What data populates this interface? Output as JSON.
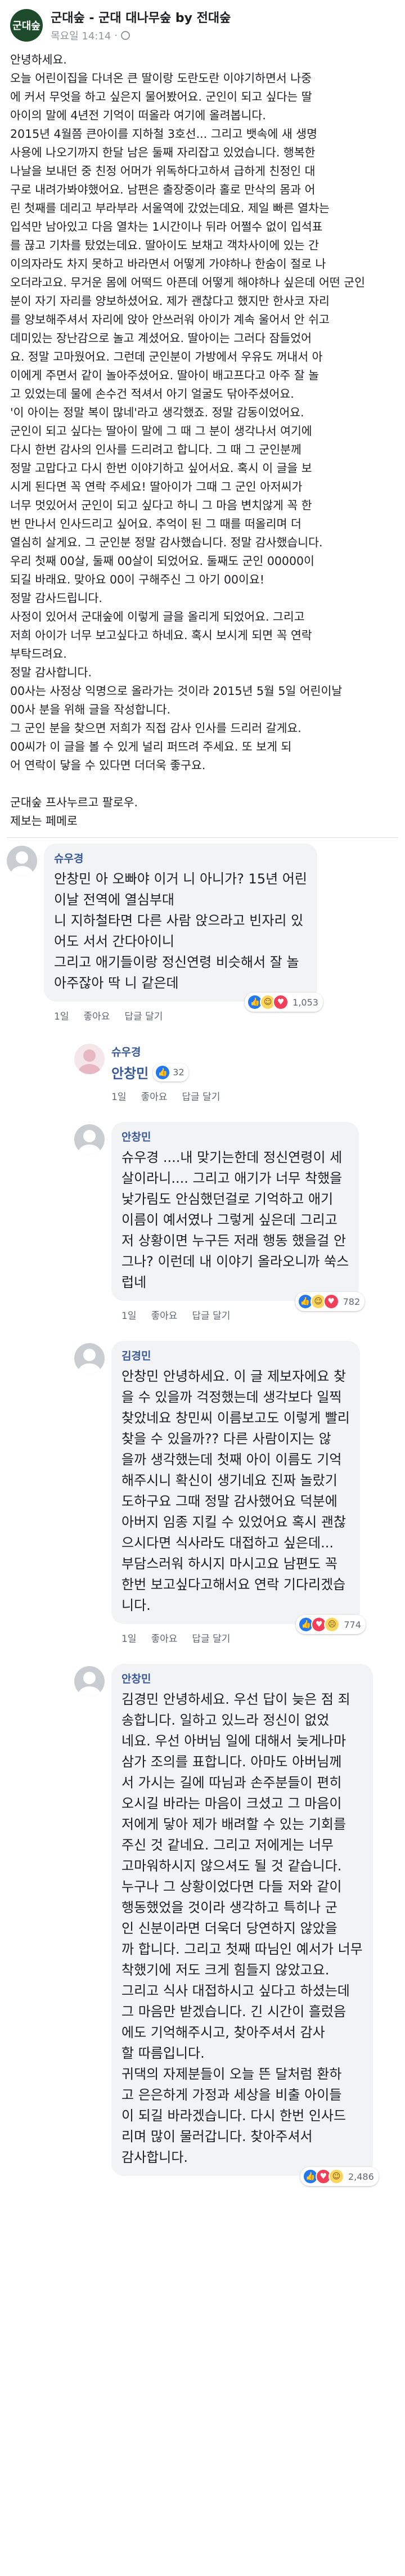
{
  "post": {
    "title": "군대숲 - 군대 대나무숲 by 전대숲",
    "avatar_text": "군대숲",
    "time": "목요일 14:14",
    "privacy_dot": "·",
    "body": "안녕하세요.\n오늘 어린이집을 다녀온 큰 딸이랑 도란도란 이야기하면서 나중\n에 커서 무엇을 하고 싶은지 물어봤어요. 군인이 되고 싶다는 딸\n아이의 말에 4년전 기억이 떠올라 여기에 올려봅니다.\n2015년 4월쯤 큰아이를 지하철 3호선... 그리고 뱃속에 새 생명\n사용에 나오기까지 한달 남은 둘째 자리잡고 있었습니다. 행복한\n나날을 보내던 중 친정 어머가 위독하다고하셔 급하게 친정인 대\n구로 내려가봐야했어요. 남편은 출장중이라 홀로 만삭의 몸과 어\n린 첫째를 데리고 부라부라 서울역에 갔었는데요. 제일 빠른 열차는\n입석만 남아있고 다음 열차는 1시간이나 뒤라 어쩔수 없이 입석표\n를 끊고 기차를 탔었는데요. 딸아이도 보채고 객차사이에 있는 간\n이의자라도 차지 못하고 바라면서 어떻게 가야하나 한숨이 절로 나\n오더라고요. 무거운 몸에 어떡드 아픈데 어떻게 해야하나 싶은데 어떤 군인\n분이 자기 자리를 양보하셨어요. 제가 괜찮다고 했지만 한사코 자리\n를 양보해주셔서 자리에 앉아 안쓰러워 아이가 계속 울어서 안 쉬고\n데미있는 장난감으로 놀고 계셨어요. 딸아이는 그러다 잠들었어\n요. 정말 고마웠어요. 그런데 군인분이 가방에서 우유도 꺼내서 아\n이에게 주면서 같이 놀아주셨어요. 딸아이 배고프다고 아주 잘 놀\n고 있었는데 물에 손수건 적셔서 아기 얼굴도 닦아주셨어요.\n'이 아이는 정말 복이 많네'라고 생각했죠. 정말 감동이었어요.\n군인이 되고 싶다는 딸아이 말에 그 때 그 분이 생각나서 여기에\n다시 한번 감사의 인사를 드리려고 합니다. 그 때 그 군인분께\n정말 고맙다고 다시 한번 이야기하고 싶어서요. 혹시 이 글을 보\n시게 된다면 꼭 연락 주세요! 딸아이가 그때 그 군인 아저씨가\n너무 멋있어서 군인이 되고 싶다고 하니 그 마음 변치않게 꼭 한\n번 만나서 인사드리고 싶어요. 추억이 된 그 때를 떠올리며 더 \n열심히 살게요. 그 군인분 정말 감사했습니다. 정말 감사했습니다.\n우리 첫째 00살, 둘째 00살이 되었어요. 둘째도 군인 00000이\n되길 바래요. 맞아요 00이 구해주신 그 아기 00이요!\n정말 감사드립니다.\n사정이 있어서 군대숲에 이렇게 글을 올리게 되었어요. 그리고\n저희 아이가 너무 보고싶다고 하네요. 혹시 보시게 되면 꼭 연락\n부탁드려요.\n정말 감사합니다.\n00사는 사정상 익명으로 올라가는 것이라 2015년 5월 5일 어린이날\n00사 분을 위해 글을 작성합니다.\n그 군인 분을 찾으면 저희가 직접 감사 인사를 드리러 갈게요.\n00씨가 이 글을 볼 수 있게 널리 퍼뜨려 주세요. 또 보게 되\n어 연락이 닿을 수 있다면 더더욱 좋구요.\n\n군대숲 프사누르고 팔로우.\n제보는 페메로"
  },
  "comments": [
    {
      "name": "슈우경",
      "text": "안창민 아 오빠야 이거 니 아니가? 15년 어린\n이날 전역에 열심부대\n니 지하철타면 다른 사람 앉으라고 빈자리 있\n어도 서서 간다아이니\n그리고 애기들이랑 정신연령 비슷해서 잘 놀\n아주잖아 딱 니 같은데",
      "reaction_count": "1,053",
      "actions": [
        "1일",
        "좋아요",
        "답글 달기"
      ]
    },
    {
      "name": "슈우경",
      "text": "안창민",
      "like_count": "32",
      "actions": [
        "1일",
        "좋아요",
        "답글 달기"
      ]
    },
    {
      "name": "안창민",
      "text": "슈우경 ....내 맞기는한데 정신연령이 세\n살이라니.... 그리고 애기가 너무 착했을\n낯가림도 안심했던걸로 기억하고 애기\n이름이 예서였나 그렇게 싶은데 그리고\n저 상황이면 누구든 저래 행동 했을걸 안\n그나? 이런데 내 이야기 올라오니까 쑥스\n럽네",
      "reaction_count": "782",
      "actions": [
        "1일",
        "좋아요",
        "답글 달기"
      ]
    },
    {
      "name": "김경민",
      "text": "안창민 안녕하세요. 이 글 제보자에요 찾\n을 수 있을까 걱정했는데 생각보다 일찍\n찾았네요 창민씨 이름보고도 이렇게 빨리\n찾을 수 있을까?? 다른 사람이지는 않\n을까 생각했는데 첫째 아이 이름도 기억\n해주시니 확신이 생기네요 진짜 놀랐기\n도하구요 그때 정말 감사했어요 덕분에\n아버지 임종 지킬 수 있었어요 혹시 괜찮\n으시다면 식사라도 대접하고 싶은데...\n부담스러워 하시지 마시고요 남편도 꼭\n한번 보고싶다고해서요 연락 기다리겠습\n니다.",
      "reaction_count": "774",
      "actions": [
        "1일",
        "좋아요",
        "답글 달기"
      ]
    },
    {
      "name": "안창민",
      "text": "김경민 안녕하세요. 우선 답이 늦은 점 죄\n송합니다. 일하고 있느라 정신이 없었\n네요. 우선 아버님 일에 대해서 늦게나마\n삼가 조의를 표합니다. 아마도 아버님께\n서 가시는 길에 따님과 손주분들이 편히\n오시길 바라는 마음이 크셨고 그 마음이\n저에게 닿아 제가 배려할 수 있는 기회를\n주신 것 같네요. 그리고 저에게는 너무\n고마워하시지 않으셔도 될 것 같습니다.\n누구나 그 상황이었다면 다들 저와 같이\n행동했었을 것이라 생각하고 특히나 군\n인 신분이라면 더욱더 당연하지 않았을\n까 합니다. 그리고 첫째 따님인 예서가 너무\n착했기에 저도 크게 힘들지 않았고요.\n그리고 식사 대접하시고 싶다고 하셨는데\n그 마음만 받겠습니다. 긴 시간이 흘렀음\n에도 기억해주시고, 찾아주셔서 감사\n할 따름입니다.\n귀댁의 자제분들이 오늘 뜬 달처럼 환하\n고 은은하게 가정과 세상을 비출 아이들\n이 되길 바라겠습니다. 다시 한번 인사드\n리며 많이 물러갑니다. 찾아주셔서\n감사합니다.",
      "reaction_count": "2,486",
      "actions": [
        "1일",
        "좋아요",
        "답글 달기"
      ]
    }
  ]
}
